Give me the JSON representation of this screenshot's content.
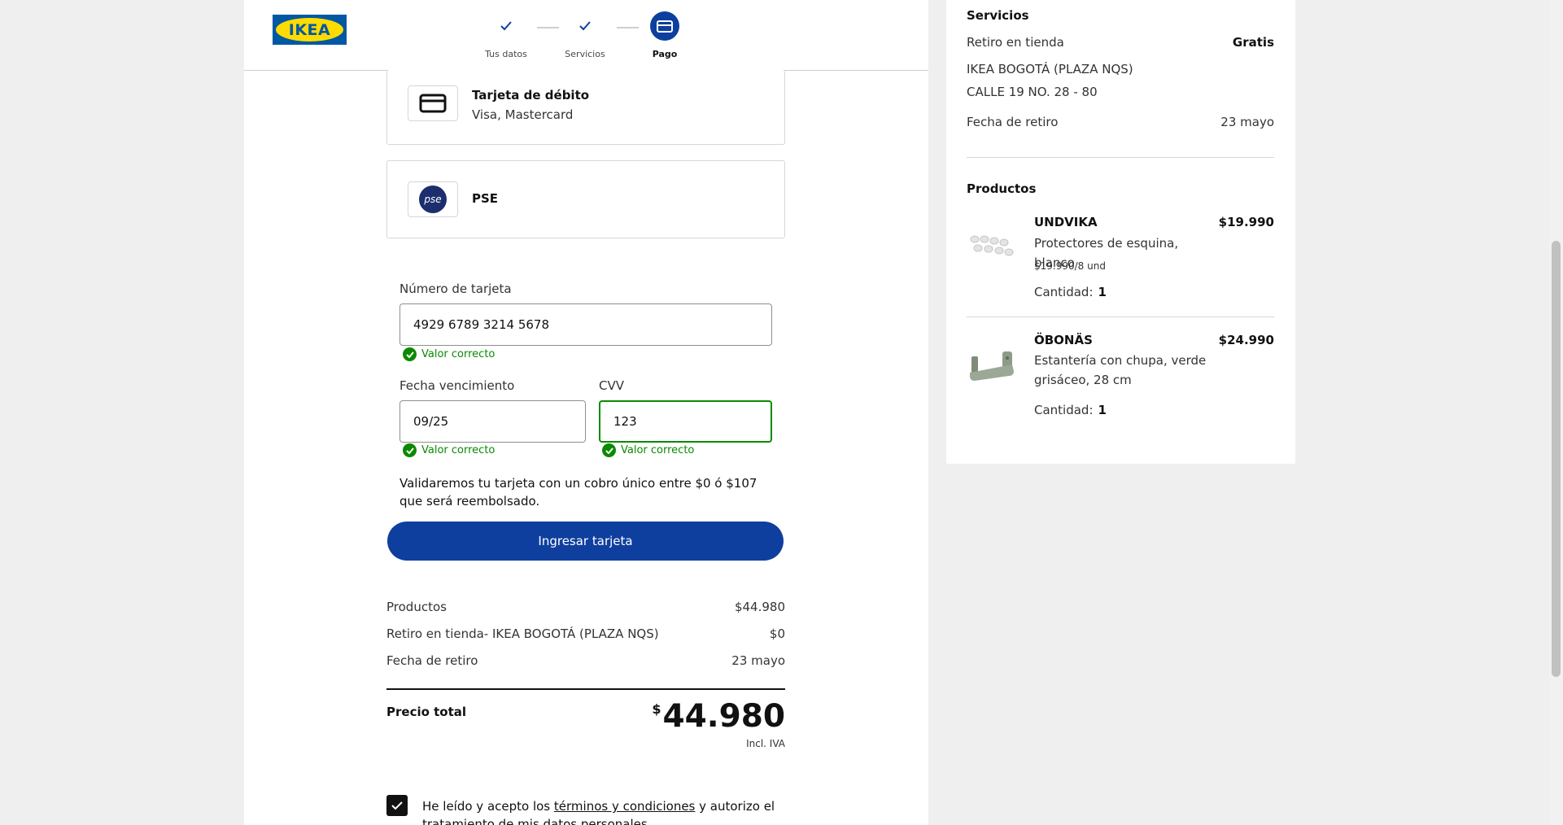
{
  "header": {
    "logo_text": "IKEA",
    "steps": [
      {
        "label": "Tus datos",
        "state": "done"
      },
      {
        "label": "Servicios",
        "state": "done"
      },
      {
        "label": "Pago",
        "state": "active"
      }
    ]
  },
  "payment_options": [
    {
      "title": "Tarjeta de débito",
      "subtitle": "Visa, Mastercard",
      "icon": "card-icon"
    },
    {
      "title": "PSE",
      "subtitle": "",
      "icon": "pse-logo",
      "logo_text": "pse"
    }
  ],
  "card_form": {
    "number_label": "Número de tarjeta",
    "number_value": "4929 6789 3214 5678",
    "expiry_label": "Fecha vencimiento",
    "expiry_value": "09/25",
    "cvv_label": "CVV",
    "cvv_value": "123",
    "valid_msg": "Valor correcto",
    "info": "Validaremos tu tarjeta con un cobro único entre $0 ó $107 que será reembolsado.",
    "submit_label": "Ingresar tarjeta"
  },
  "summary": {
    "rows": [
      {
        "label": "Productos",
        "value": "$44.980"
      },
      {
        "label": "Retiro en tienda- IKEA BOGOTÁ (PLAZA NQS)",
        "value": "$0"
      },
      {
        "label": "Fecha de retiro",
        "value": "23 mayo"
      }
    ],
    "total_label": "Precio total",
    "total_currency": "$",
    "total_value": "44.980",
    "incl_iva": "Incl. IVA"
  },
  "terms": {
    "prefix": "He leído y acepto los ",
    "link": "términos y condiciones",
    "suffix": " y autorizo el tratamiento de mis datos personales",
    "checked": true
  },
  "sidebar": {
    "services_title": "Servicios",
    "pickup_label": "Retiro en tienda",
    "pickup_value": "Gratis",
    "store_name": "IKEA BOGOTÁ (PLAZA NQS)",
    "store_address": "CALLE 19 NO. 28 - 80",
    "date_label": "Fecha de retiro",
    "date_value": "23 mayo",
    "products_title": "Productos",
    "qty_label": "Cantidad:",
    "products": [
      {
        "name": "UNDVIKA",
        "price": "$19.990",
        "desc": "Protectores de esquina, blanco",
        "unit": "$19.990/8 und",
        "qty": "1"
      },
      {
        "name": "ÖBONÄS",
        "price": "$24.990",
        "desc": "Estantería con chupa, verde grisáceo, 28 cm",
        "unit": "",
        "qty": "1"
      }
    ]
  },
  "colors": {
    "primary": "#0f3f9e",
    "valid": "#0a8a00",
    "ikea_blue": "#0058a3",
    "ikea_yellow": "#ffdb00"
  }
}
